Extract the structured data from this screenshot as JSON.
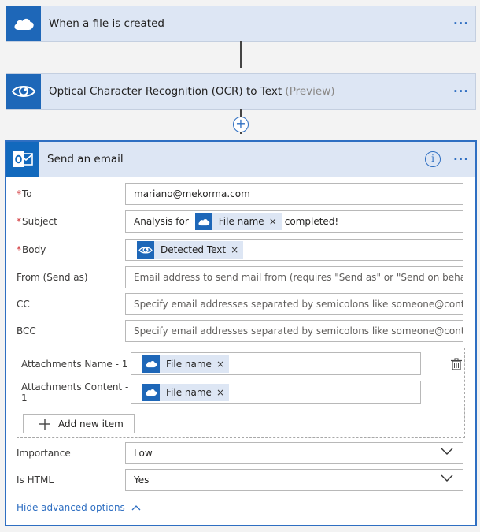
{
  "trigger": {
    "title": "When a file is created",
    "icon": "onedrive-cloud-icon"
  },
  "ocr_step": {
    "title": "Optical Character Recognition (OCR) to Text",
    "badge": "(Preview)",
    "icon": "eye-icon"
  },
  "more_label": "···",
  "add_step_symbol": "+",
  "email_step": {
    "title": "Send an email",
    "icon": "outlook-icon",
    "info_symbol": "i",
    "required_marker": "*",
    "fields": {
      "to": {
        "label": "To",
        "value": "mariano@mekorma.com"
      },
      "subject": {
        "label": "Subject",
        "prefix": "Analysis for",
        "token": "File name",
        "suffix": "completed!"
      },
      "body": {
        "label": "Body",
        "token": "Detected Text"
      },
      "from": {
        "label": "From (Send as)",
        "placeholder": "Email address to send mail from (requires \"Send as\" or \"Send on behalf of\" pe"
      },
      "cc": {
        "label": "CC",
        "placeholder": "Specify email addresses separated by semicolons like someone@contoso.con"
      },
      "bcc": {
        "label": "BCC",
        "placeholder": "Specify email addresses separated by semicolons like someone@contoso.con"
      }
    },
    "attachments": {
      "name_label": "Attachments Name - 1",
      "name_token": "File name",
      "content_label_line1": "Attachments Content -",
      "content_label_line2": "1",
      "content_token": "File name",
      "add_label": "Add new item"
    },
    "importance": {
      "label": "Importance",
      "value": "Low"
    },
    "is_html": {
      "label": "Is HTML",
      "value": "Yes"
    },
    "hide_advanced": "Hide advanced options"
  },
  "token_remove": "×",
  "colors": {
    "accent": "#2f6fc2",
    "tile": "#1e67b8",
    "required": "#d13438"
  }
}
